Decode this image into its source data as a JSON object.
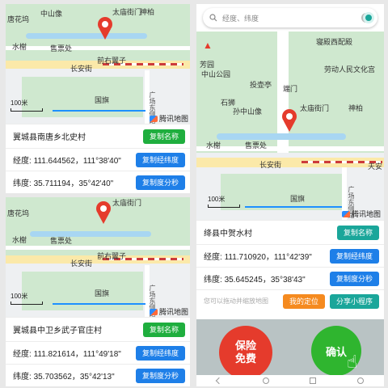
{
  "panel1": {
    "map": {
      "labels": [
        "唐花坞",
        "中山像",
        "太庙街门",
        "神柏",
        "水榭",
        "售票处",
        "前右翼子",
        "长安街",
        "国旗",
        "广场东侧路"
      ],
      "scale": "100米",
      "brand": "腾讯地图"
    },
    "village": "翼城县南唐乡北史村",
    "copy_name": "复制名称",
    "lng_label": "经度:",
    "lng_value": "111.644562，111°38'40\"",
    "copy_lnglat": "复制经纬度",
    "lat_label": "纬度:",
    "lat_value": "35.711194，35°42'40\"",
    "copy_dms": "复制度分秒"
  },
  "panel2": {
    "map": {
      "labels": [
        "唐花坞",
        "太庙街门",
        "水榭",
        "售票处",
        "前右翼子",
        "长安街",
        "国旗",
        "广场东侧路"
      ],
      "scale": "100米",
      "brand": "腾讯地图"
    },
    "village": "翼城县中卫乡武子官庄村",
    "copy_name": "复制名称",
    "lng_label": "经度:",
    "lng_value": "111.821614，111°49'18\"",
    "copy_lnglat": "复制经纬度",
    "lat_label": "纬度:",
    "lat_value": "35.703562，35°42'13\"",
    "copy_dms": "复制度分秒"
  },
  "panel3": {
    "search_placeholder": "经度、纬度",
    "map": {
      "labels": [
        "寝殿西配殿",
        "劳动人民文化宫",
        "芳园",
        "中山公园",
        "投壶亭",
        "端门",
        "石狮",
        "孙中山像",
        "太庙街门",
        "神柏",
        "水榭",
        "售票处",
        "长安街",
        "天安",
        "国旗",
        "广场东侧路"
      ],
      "scale": "100米",
      "brand": "腾讯地图"
    },
    "village": "绛县中贺水村",
    "copy_name": "复制名称",
    "lng_label": "经度:",
    "lng_value": "111.710920，111°42'39\"",
    "copy_lnglat": "复制经纬度",
    "lat_label": "纬度:",
    "lat_value": "35.645245，35°38'43\"",
    "copy_dms": "复制度分秒",
    "hint": "您可以拖动并缩放地图",
    "my_location": "我的定位",
    "share": "分享小程序",
    "insurance_line1": "保险",
    "insurance_line2": "免费",
    "confirm": "确认"
  },
  "colors": {
    "green_button": "#1fae3e",
    "blue_button": "#1e7fe8",
    "orange_button": "#f58a1f",
    "teal_button": "#1aa69a",
    "red_circle": "#e53b2c",
    "green_circle": "#2fb52f"
  }
}
